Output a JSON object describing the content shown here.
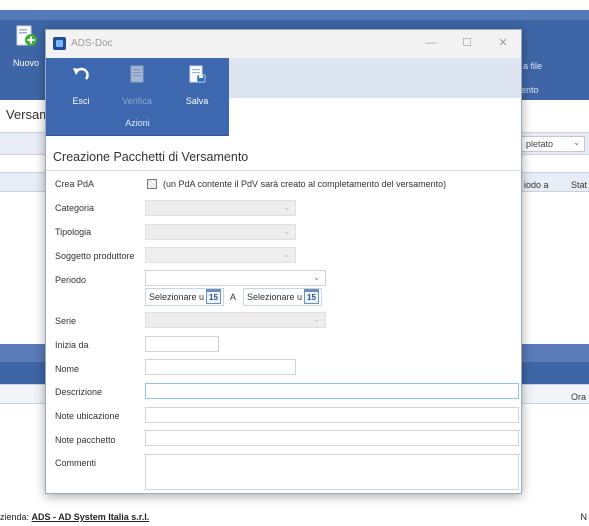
{
  "background": {
    "new_label": "Nuovo",
    "right_label_top": "a file",
    "right_label_bottom": "ento",
    "title": "Versam",
    "filter_value": "pletato",
    "col_period_to": "iodo a",
    "col_state": "Stat",
    "col_ora": "Ora",
    "footer_prefix": "zienda:",
    "footer_company": "ADS - AD System Italia s.r.l.",
    "footer_right": "N"
  },
  "window": {
    "title": "ADS-Doc",
    "minimize": "—",
    "maximize": "☐",
    "close": "✕"
  },
  "ribbon": {
    "esci": "Esci",
    "verifica": "Verifica",
    "salva": "Salva",
    "group": "Azioni"
  },
  "form": {
    "heading": "Creazione Pacchetti di Versamento",
    "crea_pda_label": "Crea PdA",
    "crea_pda_text": "(un PdA contente il PdV sarà creato al completamento del versamento)",
    "categoria_label": "Categoria",
    "tipologia_label": "Tipologia",
    "soggetto_label": "Soggetto produttore",
    "periodo_label": "Periodo",
    "date_from": "Selezionare u",
    "date_sep": "A",
    "date_to": "Selezionare u",
    "calendar_day": "15",
    "serie_label": "Serie",
    "inizia_da_label": "Inizia da",
    "nome_label": "Nome",
    "descrizione_label": "Descrizione",
    "note_ubicazione_label": "Note ubicazione",
    "note_pacchetto_label": "Note pacchetto",
    "commenti_label": "Commenti"
  },
  "icons": {
    "esci": "undo-arrow-icon",
    "verifica": "document-check-icon",
    "salva": "save-document-icon",
    "nuovo": "new-document-icon",
    "calendar": "calendar-icon",
    "dropdown": "chevron-down-icon"
  },
  "colors": {
    "ribbon": "#3d68b0",
    "app_band": "#3e66a6",
    "focus_border": "#8fc3e8"
  }
}
